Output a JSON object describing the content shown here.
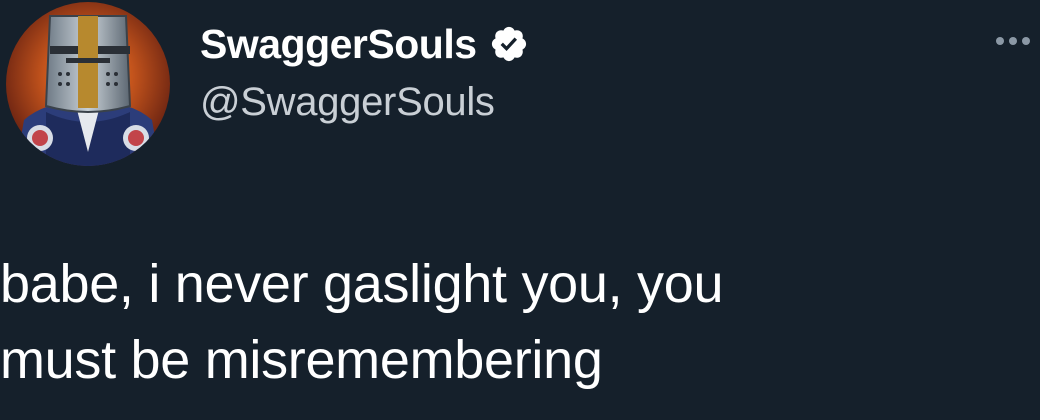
{
  "author": {
    "display_name": "SwaggerSouls",
    "handle": "@SwaggerSouls",
    "avatar_icon": "knight-helmet-avatar",
    "verified_icon": "verified-badge-icon"
  },
  "actions": {
    "more_icon": "more-options-icon"
  },
  "tweet": {
    "text": "babe, i never gaslight you, you\nmust be misremembering"
  },
  "colors": {
    "background": "#15202b",
    "text_primary": "#ffffff",
    "text_secondary": "#c9cfd5",
    "icon_muted": "#8b98a5"
  }
}
